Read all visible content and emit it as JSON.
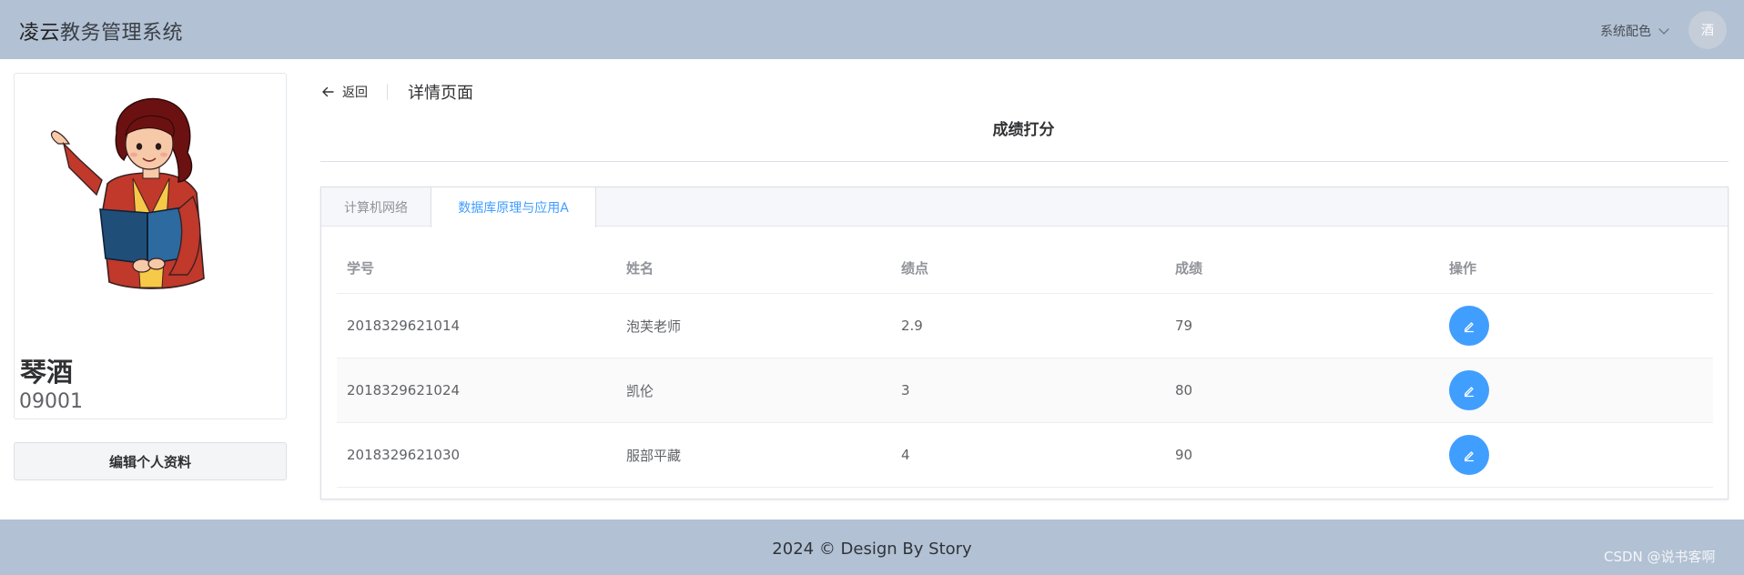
{
  "header": {
    "app_title_lead": "凌云",
    "app_title_rest": "教务管理系统",
    "theme_menu_label": "系统配色",
    "avatar_text": "酒"
  },
  "profile": {
    "name": "琴酒",
    "id": "09001",
    "edit_button_label": "编辑个人资料"
  },
  "page_header": {
    "back_label": "返回",
    "title": "详情页面"
  },
  "section": {
    "title": "成绩打分"
  },
  "tabs": [
    {
      "label": "计算机网络",
      "active": false
    },
    {
      "label": "数据库原理与应用A",
      "active": true
    }
  ],
  "table": {
    "columns": [
      "学号",
      "姓名",
      "绩点",
      "成绩",
      "操作"
    ],
    "rows": [
      {
        "student_id": "2018329621014",
        "name": "泡芙老师",
        "gpa": "2.9",
        "score": "79"
      },
      {
        "student_id": "2018329621024",
        "name": "凯伦",
        "gpa": "3",
        "score": "80"
      },
      {
        "student_id": "2018329621030",
        "name": "服部平藏",
        "gpa": "4",
        "score": "90"
      }
    ]
  },
  "footer": {
    "text": "2024 © Design By Story",
    "watermark": "CSDN @说书客啊"
  },
  "colors": {
    "topbar": "#b2c1d3",
    "accent": "#409eff"
  },
  "icons": {
    "back": "arrow-left-icon",
    "edit": "edit-pen-icon",
    "menu_chevron": "chevron-down-icon"
  }
}
